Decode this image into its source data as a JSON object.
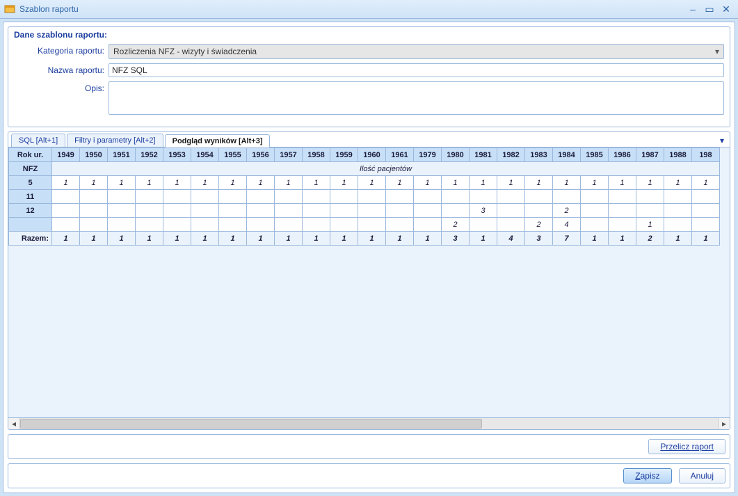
{
  "window": {
    "title": "Szablon raportu"
  },
  "panel_title": "Dane szablonu raportu:",
  "form": {
    "category_label": "Kategoria raportu:",
    "category_value": "Rozliczenia NFZ - wizyty i świadczenia",
    "name_label": "Nazwa raportu:",
    "name_value": "NFZ SQL",
    "desc_label": "Opis:",
    "desc_value": ""
  },
  "tabs": {
    "items": [
      {
        "label": "SQL [Alt+1]",
        "active": false
      },
      {
        "label": "Filtry i parametry [Alt+2]",
        "active": false
      },
      {
        "label": "Podgląd wyników [Alt+3]",
        "active": true
      }
    ]
  },
  "grid": {
    "row_header": "Rok ur.",
    "years": [
      "1949",
      "1950",
      "1951",
      "1952",
      "1953",
      "1954",
      "1955",
      "1956",
      "1957",
      "1958",
      "1959",
      "1960",
      "1961",
      "1979",
      "1980",
      "1981",
      "1982",
      "1983",
      "1984",
      "1985",
      "1986",
      "1987",
      "1988",
      "198"
    ],
    "nfz_label": "NFZ",
    "nfz_span_text": "Ilość pacjentów",
    "rows": [
      {
        "hdr": "5",
        "cells": [
          "1",
          "1",
          "1",
          "1",
          "1",
          "1",
          "1",
          "1",
          "1",
          "1",
          "1",
          "1",
          "1",
          "1",
          "1",
          "1",
          "1",
          "1",
          "1",
          "1",
          "1",
          "1",
          "1",
          "1"
        ]
      },
      {
        "hdr": "11",
        "cells": [
          "",
          "",
          "",
          "",
          "",
          "",
          "",
          "",
          "",
          "",
          "",
          "",
          "",
          "",
          "",
          "",
          "",
          "",
          "",
          "",
          "",
          "",
          "",
          ""
        ]
      },
      {
        "hdr": "12",
        "cells": [
          "",
          "",
          "",
          "",
          "",
          "",
          "",
          "",
          "",
          "",
          "",
          "",
          "",
          "",
          "",
          "3",
          "",
          "",
          "2",
          "",
          "",
          "",
          "",
          ""
        ]
      },
      {
        "hdr": "",
        "cells": [
          "",
          "",
          "",
          "",
          "",
          "",
          "",
          "",
          "",
          "",
          "",
          "",
          "",
          "",
          "2",
          "",
          "",
          "2",
          "4",
          "",
          "",
          "1",
          "",
          ""
        ]
      }
    ],
    "razem_label": "Razem:",
    "razem_cells": [
      "1",
      "1",
      "1",
      "1",
      "1",
      "1",
      "1",
      "1",
      "1",
      "1",
      "1",
      "1",
      "1",
      "1",
      "3",
      "1",
      "4",
      "3",
      "7",
      "1",
      "1",
      "2",
      "1",
      "1"
    ]
  },
  "buttons": {
    "recalc": "Przelicz raport",
    "save_pre": "Z",
    "save_post": "apisz",
    "cancel_pre": "",
    "cancel_post": "Anuluj"
  }
}
